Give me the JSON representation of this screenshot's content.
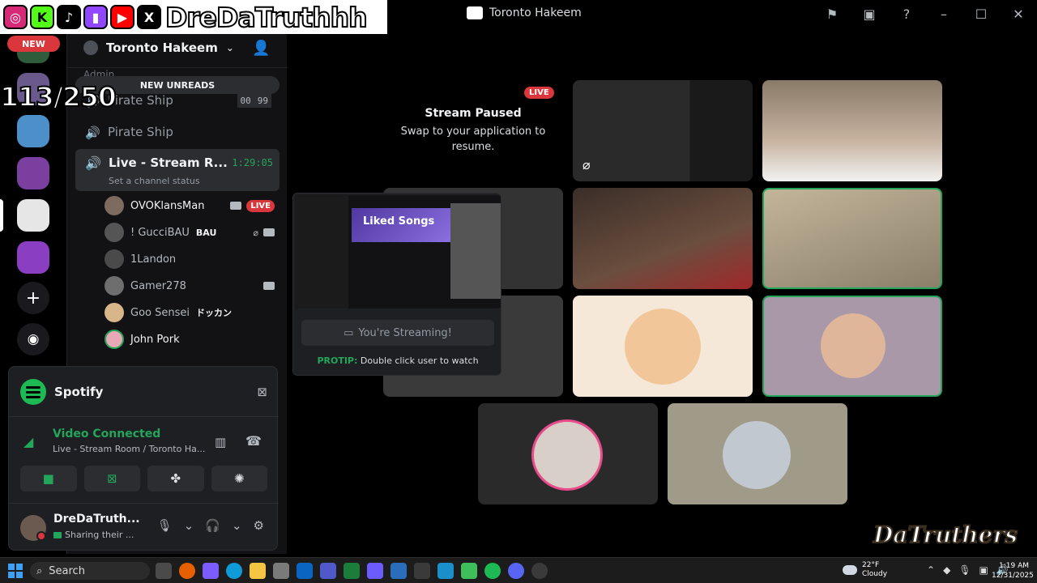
{
  "window": {
    "title": "Toronto Hakeem",
    "toolbar_icons": [
      "flag-icon",
      "inbox-icon",
      "help-icon"
    ],
    "controls": [
      "minimize-icon",
      "maximize-icon",
      "close-icon"
    ]
  },
  "overlay": {
    "social_icons": [
      "instagram-icon",
      "kick-icon",
      "tiktok-icon",
      "twitch-icon",
      "youtube-icon",
      "x-icon"
    ],
    "name": "DreDaTruthhh",
    "counter": "113/250",
    "watermark": "DaTruthers"
  },
  "rail": {
    "new_badge": "NEW",
    "add_server_icon": "plus-icon",
    "discover_icon": "compass-icon"
  },
  "sidebar": {
    "server_name": "Toronto Hakeem",
    "admin_label": "Admin",
    "new_unreads": "NEW UNREADS",
    "channels": [
      {
        "name": "Pirate Ship",
        "counts": [
          "00",
          "99"
        ]
      },
      {
        "name": "Pirate Ship"
      }
    ],
    "active_channel": {
      "name": "Live - Stream R...",
      "timer": "1:29:05",
      "status": "Set a channel status"
    },
    "users": [
      {
        "name": "OVOKlansMan",
        "badge": "LIVE"
      },
      {
        "name": "! GucciBAU",
        "tag": "BAU"
      },
      {
        "name": "1Landon"
      },
      {
        "name": "Gamer278"
      },
      {
        "name": "Goo Sensei",
        "tag": "ドッカン"
      },
      {
        "name": "John Pork"
      }
    ]
  },
  "panel": {
    "activity": "Spotify",
    "voice_status": "Video Connected",
    "voice_location": "Live - Stream Room / Toronto Ha...",
    "username": "DreDaTruth...",
    "user_status": "Sharing their ..."
  },
  "stage": {
    "paused_title": "Stream Paused",
    "paused_sub": "Swap to your application to resume.",
    "live_badge": "LIVE"
  },
  "popup": {
    "preview_title": "Liked Songs",
    "streaming_label": "You're Streaming!",
    "protip_label": "PROTIP:",
    "protip_text": "Double click user to watch"
  },
  "taskbar": {
    "search": "Search",
    "temp": "22°F",
    "weather": "Cloudy",
    "time": "1:19 AM",
    "date": "12/31/2025"
  }
}
